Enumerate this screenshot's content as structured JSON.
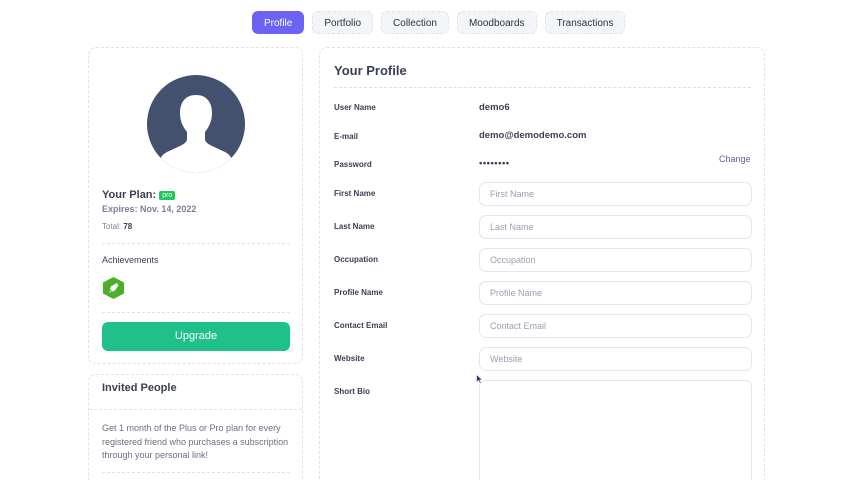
{
  "tabs": [
    {
      "label": "Profile",
      "active": true
    },
    {
      "label": "Portfolio",
      "active": false
    },
    {
      "label": "Collection",
      "active": false
    },
    {
      "label": "Moodboards",
      "active": false
    },
    {
      "label": "Transactions",
      "active": false
    }
  ],
  "plan": {
    "label": "Your Plan:",
    "badge": "pro",
    "expires": "Expires: Nov. 14, 2022",
    "total_label": "Total:",
    "total_value": "78",
    "achievements_label": "Achievements",
    "upgrade_label": "Upgrade"
  },
  "invite": {
    "title": "Invited People",
    "text": "Get 1 month of the Plus or Pro plan for every registered friend who purchases a subscription through your personal link!"
  },
  "profile": {
    "title": "Your Profile",
    "username_label": "User Name",
    "username_value": "demo6",
    "email_label": "E-mail",
    "email_value": "demo@demodemo.com",
    "password_label": "Password",
    "password_value": "••••••••",
    "change_label": "Change",
    "first_name": {
      "label": "First Name",
      "placeholder": "First Name",
      "value": ""
    },
    "last_name": {
      "label": "Last Name",
      "placeholder": "Last Name",
      "value": ""
    },
    "occupation": {
      "label": "Occupation",
      "placeholder": "Occupation",
      "value": ""
    },
    "profile_name": {
      "label": "Profile Name",
      "placeholder": "Profile Name",
      "value": ""
    },
    "contact_email": {
      "label": "Contact Email",
      "placeholder": "Contact Email",
      "value": ""
    },
    "website": {
      "label": "Website",
      "placeholder": "Website",
      "value": ""
    },
    "short_bio": {
      "label": "Short Bio",
      "value": ""
    }
  },
  "colors": {
    "accent": "#6c63f5",
    "upgrade": "#1fc08a",
    "badge": "#22c55e",
    "avatar_bg": "#44516e",
    "achievement": "#4caf2a"
  },
  "icons": {
    "avatar": "user-silhouette-icon",
    "achievement": "rocket-hexagon-icon",
    "cursor": "mouse-pointer-icon"
  }
}
